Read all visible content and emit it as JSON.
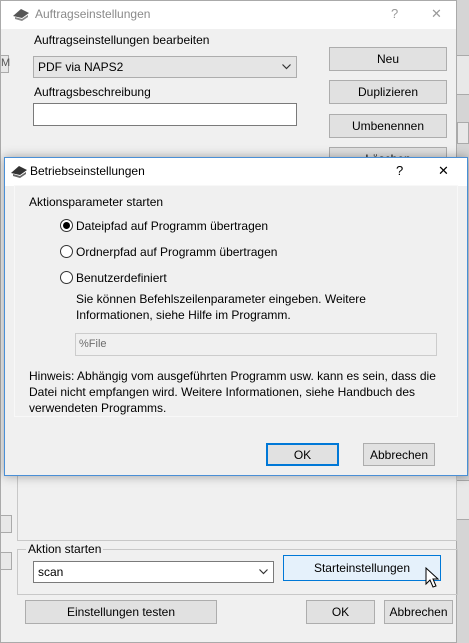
{
  "background_window": {
    "title": "Auftragseinstellungen",
    "help_glyph": "?",
    "close_glyph": "✕",
    "edit_label": "Auftragseinstellungen bearbeiten",
    "profile_value": "PDF via NAPS2",
    "description_label": "Auftragsbeschreibung",
    "description_value": "",
    "buttons": {
      "new": "Neu",
      "duplicate": "Duplizieren",
      "rename": "Umbenennen",
      "delete": "Löschen"
    },
    "action_group_label": "Aktion starten",
    "action_value": "scan",
    "start_settings_button": "Starteinstellungen",
    "test_settings_button": "Einstellungen testen",
    "ok_button": "OK",
    "cancel_button": "Abbrechen"
  },
  "dialog": {
    "title": "Betriebseinstellungen",
    "help_glyph": "?",
    "close_glyph": "✕",
    "group_label": "Aktionsparameter starten",
    "options": [
      {
        "label": "Dateipfad auf Programm übertragen",
        "selected": true
      },
      {
        "label": "Ordnerpfad auf Programm übertragen",
        "selected": false
      },
      {
        "label": "Benutzerdefiniert",
        "selected": false
      }
    ],
    "custom_hint": "Sie können Befehlszeilenparameter eingeben. Weitere Informationen, siehe Hilfe im Programm.",
    "custom_value": "%File",
    "note": "Hinweis: Abhängig vom ausgeführten Programm usw. kann es sein, dass die Datei nicht empfangen wird. Weitere Informationen, siehe Handbuch des verwendeten Programms.",
    "ok_button": "OK",
    "cancel_button": "Abbrechen"
  },
  "icons": {
    "app_icon": "scanner-app-icon",
    "cursor": "mouse-pointer-icon"
  },
  "colors": {
    "accent": "#0078d7",
    "window_bg": "#f0f0f0",
    "disabled_text": "#6d6d6d"
  }
}
